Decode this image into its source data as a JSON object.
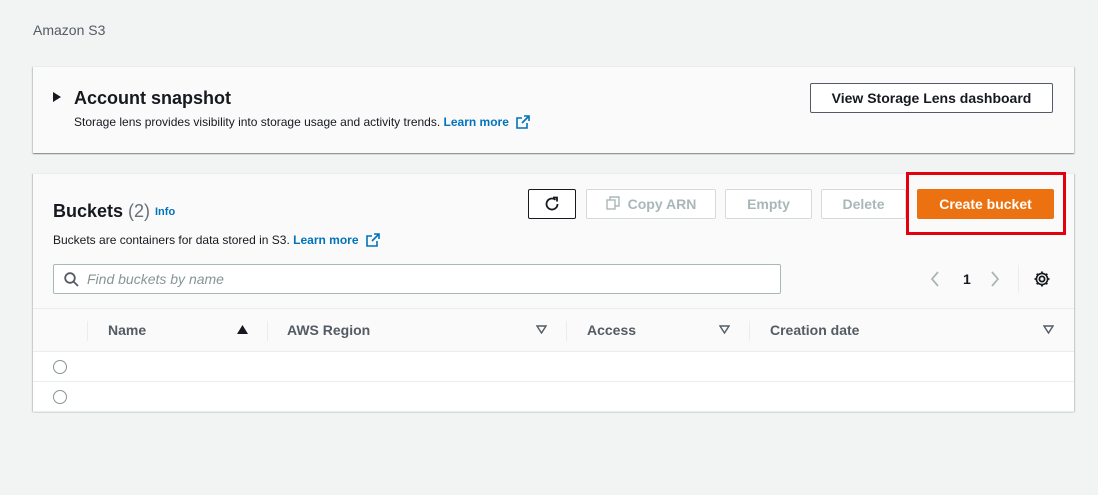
{
  "breadcrumb": "Amazon S3",
  "snapshot": {
    "title": "Account snapshot",
    "description": "Storage lens provides visibility into storage usage and activity trends.",
    "learn_more": "Learn more",
    "lens_button": "View Storage Lens dashboard"
  },
  "buckets": {
    "title": "Buckets",
    "count": "(2)",
    "info": "Info",
    "description": "Buckets are containers for data stored in S3.",
    "learn_more": "Learn more",
    "buttons": {
      "copy_arn": "Copy ARN",
      "empty": "Empty",
      "delete": "Delete",
      "create": "Create bucket"
    },
    "search_placeholder": "Find buckets by name",
    "page": "1",
    "columns": [
      "Name",
      "AWS Region",
      "Access",
      "Creation date"
    ],
    "rows": [
      {
        "name": "",
        "region": "",
        "access": "",
        "created": ""
      },
      {
        "name": "",
        "region": "",
        "access": "",
        "created": ""
      }
    ]
  },
  "colors": {
    "primary": "#ec7211",
    "link": "#0073bb",
    "highlight": "#e3000f"
  }
}
